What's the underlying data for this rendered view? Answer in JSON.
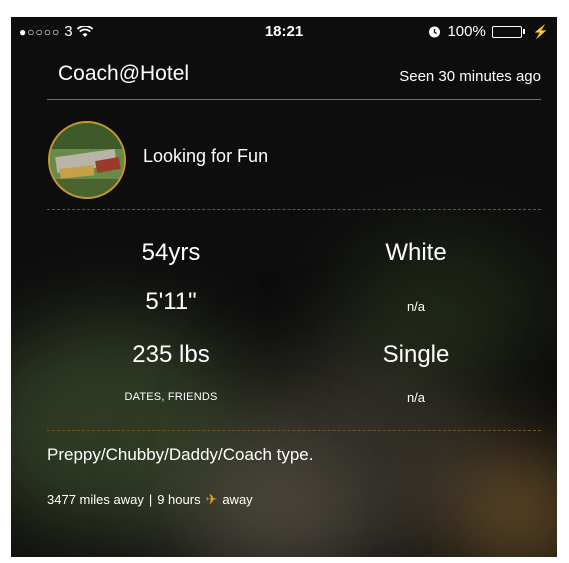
{
  "status_bar": {
    "signal": "●○○○○",
    "carrier": "3",
    "time": "18:21",
    "battery": "100%"
  },
  "header": {
    "title": "Coach@Hotel",
    "seen": "Seen 30 minutes ago"
  },
  "profile": {
    "status": "Looking for Fun"
  },
  "stats": {
    "age": "54yrs",
    "ethnicity": "White",
    "height": "5'11\"",
    "body_type": "n/a",
    "weight": "235 lbs",
    "relationship": "Single",
    "looking_for": "DATES, FRIENDS",
    "extra": "n/a"
  },
  "bio": "Preppy/Chubby/Daddy/Coach type.",
  "distance": {
    "miles": "3477 miles away",
    "separator": "|",
    "hours": "9 hours",
    "away": "away"
  },
  "colors": {
    "accent": "#c8962e",
    "battery": "#4cd964",
    "plane": "#e8a21c"
  }
}
